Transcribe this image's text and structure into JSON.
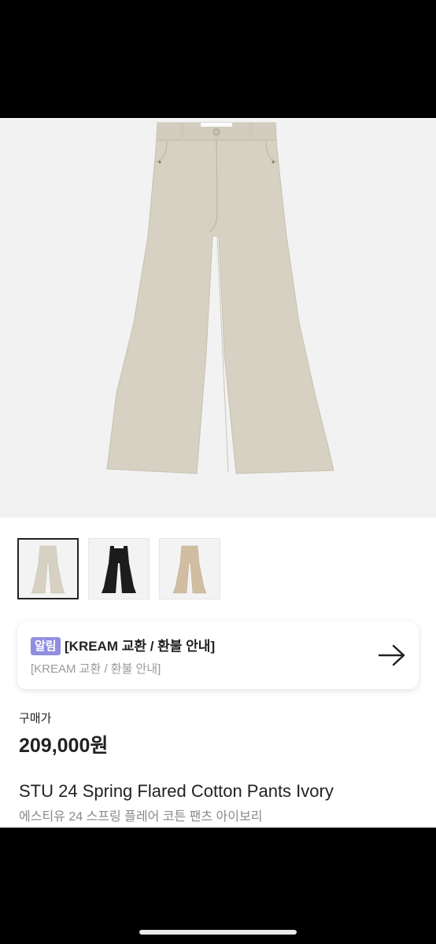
{
  "product": {
    "image_alt_main": "pants-ivory",
    "thumbnails": [
      {
        "name": "ivory",
        "color": "#d6d1c3"
      },
      {
        "name": "black",
        "color": "#1c1c1c"
      },
      {
        "name": "beige",
        "color": "#d1bda2"
      }
    ],
    "selected_thumbnail": 0
  },
  "notice": {
    "badge": "알림",
    "title": "[KREAM 교환 / 환불 안내]",
    "subtitle": "[KREAM 교환 / 환불 안내]",
    "arrow_icon": "arrow-right-icon"
  },
  "price": {
    "label": "구매가",
    "value": "209,000원"
  },
  "title": {
    "en": "STU 24 Spring Flared Cotton Pants Ivory",
    "ko": "에스티유 24 스프링 플레어 코튼 팬츠 아이보리"
  },
  "colors": {
    "badge": "#8f8ee0",
    "pants_main": "#d6d1c3"
  }
}
